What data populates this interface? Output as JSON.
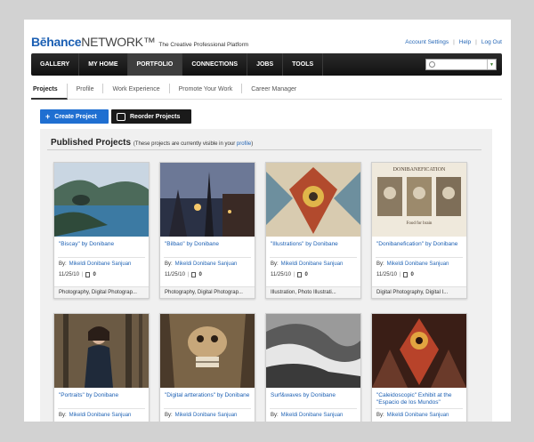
{
  "brand": {
    "name_bold": "Bēhance",
    "name_rest": "NETWORK™",
    "tagline": "The Creative Professional Platform"
  },
  "toplinks": {
    "account": "Account Settings",
    "help": "Help",
    "logout": "Log Out",
    "sep": "|"
  },
  "nav": {
    "items": [
      "GALLERY",
      "MY HOME",
      "PORTFOLIO",
      "CONNECTIONS",
      "JOBS",
      "TOOLS"
    ],
    "active": "PORTFOLIO"
  },
  "search": {
    "placeholder": ""
  },
  "tabs": [
    "Projects",
    "Profile",
    "Work Experience",
    "Promote Your Work",
    "Career Manager"
  ],
  "buttons": {
    "create": "Create Project",
    "reorder": "Reorder Projects"
  },
  "panel": {
    "title": "Published Projects",
    "note_pre": "(These projects are currently visible in your ",
    "note_link": "profile",
    "note_post": ")"
  },
  "projects": [
    {
      "title": "\"Biscay\" by Donibane",
      "by_label": "By:",
      "owner": "Mikeldi Donibane Sanjuan",
      "date": "11/25/10",
      "count": "0",
      "fields": "Photography, Digital Photograp..."
    },
    {
      "title": "\"Bilbao\" by Donibane",
      "by_label": "By:",
      "owner": "Mikeldi Donibane Sanjuan",
      "date": "11/25/10",
      "count": "0",
      "fields": "Photography, Digital Photograp..."
    },
    {
      "title": "\"Illustrations\" by Donibane",
      "by_label": "By:",
      "owner": "Mikeldi Donibane Sanjuan",
      "date": "11/25/10",
      "count": "0",
      "fields": "Illustration, Photo Illustrati..."
    },
    {
      "title": "\"Donibanefication\" by Donibane",
      "by_label": "By:",
      "owner": "Mikeldi Donibane Sanjuan",
      "date": "11/25/10",
      "count": "0",
      "fields": "Digital Photography, Digital I...",
      "thumb_caption": "DONIBANEFICATION",
      "thumb_sub": "Food for brain"
    },
    {
      "title": "\"Portraits\" by Donibane",
      "by_label": "By:",
      "owner": "Mikeldi Donibane Sanjuan"
    },
    {
      "title": "\"Digital artterations\" by Donibane",
      "by_label": "By:",
      "owner": "Mikeldi Donibane Sanjuan"
    },
    {
      "title": "Surf&waves by Donibane",
      "by_label": "By:",
      "owner": "Mikeldi Donibane Sanjuan"
    },
    {
      "title": "\"Caleidoscopic\" Exhibit at the \"Espacio de los Mundos\"",
      "by_label": "By:",
      "owner": "Mikeldi Donibane Sanjuan"
    }
  ],
  "colors": {
    "brand_blue": "#1b5fb3",
    "create_button": "#1f6fd1",
    "nav_bg": "#1a1a1a"
  }
}
